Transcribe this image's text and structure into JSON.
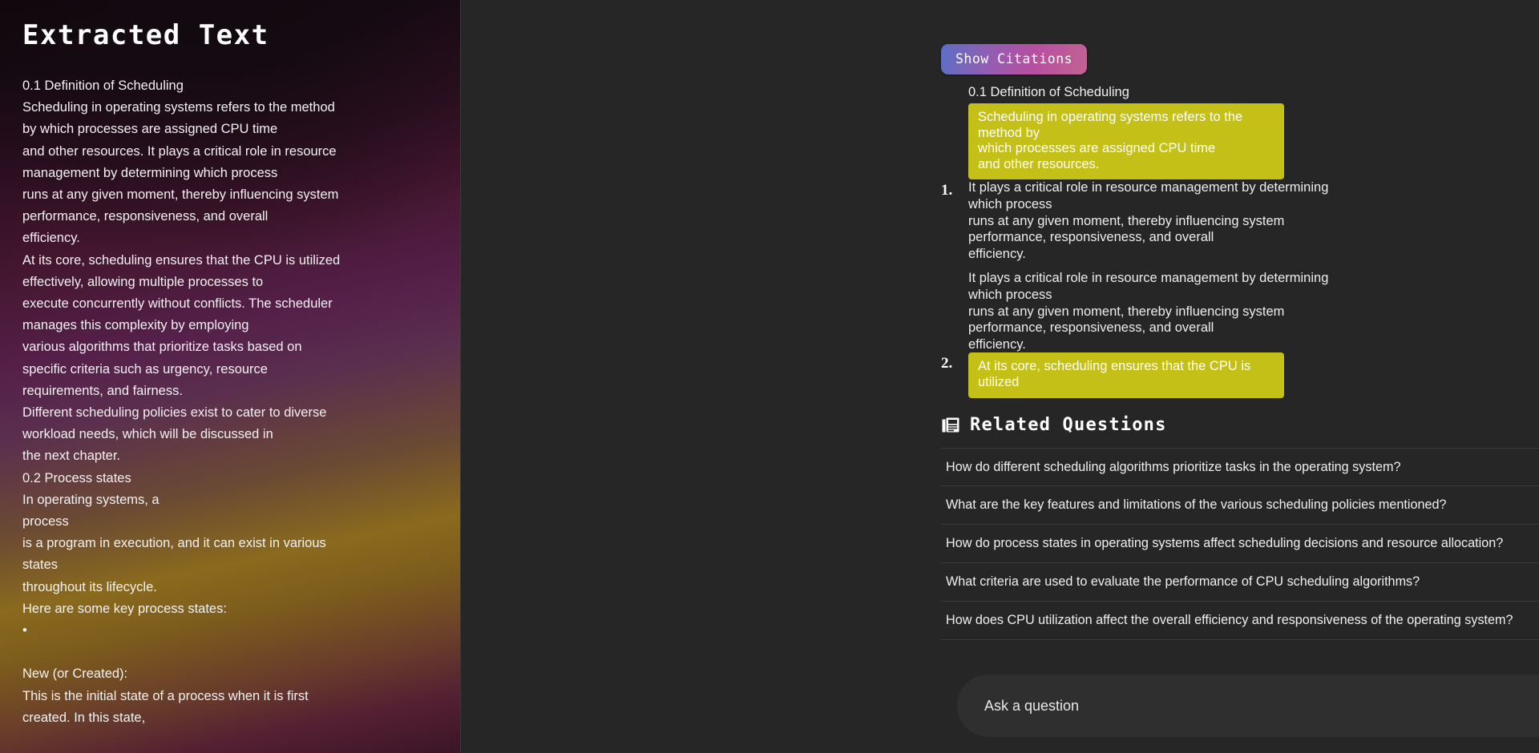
{
  "left_panel": {
    "title": "Extracted Text",
    "lines": [
      "0.1 Definition of Scheduling",
      "Scheduling in operating systems refers to the method",
      "by which processes are assigned CPU time",
      "and other resources. It plays a critical role in resource",
      "management by determining which process",
      "runs at any given moment, thereby influencing system",
      "performance, responsiveness, and overall",
      "efficiency.",
      "At its core, scheduling ensures that the CPU is utilized",
      "effectively, allowing multiple processes to",
      "execute concurrently without conflicts. The scheduler",
      "manages this complexity by employing",
      "various algorithms that prioritize tasks based on",
      "specific criteria such as urgency, resource",
      "requirements, and fairness.",
      "Different scheduling policies exist to cater to diverse",
      "workload needs, which will be discussed in",
      "the next chapter.",
      "0.2 Process states",
      "In operating systems, a",
      "process",
      "is a program in execution, and it can exist in various",
      "states",
      "throughout its lifecycle.",
      "Here are some key process states:",
      "•",
      "",
      "New (or Created):",
      "This is the initial state of a process when it is first",
      "created. In this state,"
    ]
  },
  "citations": {
    "toggle_label": "Show Citations",
    "section_heading": "0.1 Definition of Scheduling",
    "blocks": [
      {
        "marker": "",
        "highlighted": true,
        "lines": [
          "Scheduling in operating systems refers to the method by",
          "which processes are assigned CPU time",
          "and other resources."
        ]
      },
      {
        "marker": "1.",
        "highlighted": false,
        "lines": [
          "It plays a critical role in resource management by determining",
          "which process",
          "runs at any given moment, thereby influencing system",
          "performance, responsiveness, and overall",
          "efficiency."
        ]
      },
      {
        "marker": "",
        "highlighted": false,
        "lines": [
          "It plays a critical role in resource management by determining",
          "which process",
          "runs at any given moment, thereby influencing system",
          "performance, responsiveness, and overall",
          "efficiency."
        ]
      },
      {
        "marker": "2.",
        "highlighted": true,
        "lines": [
          "At its core, scheduling ensures that the CPU is utilized"
        ]
      }
    ]
  },
  "related": {
    "title": "Related Questions",
    "icon": "document-icon",
    "expand_label": "+",
    "questions": [
      "How do different scheduling algorithms prioritize tasks in the operating system?",
      "What are the key features and limitations of the various scheduling policies mentioned?",
      "How do process states in operating systems affect scheduling decisions and resource allocation?",
      "What criteria are used to evaluate the performance of CPU scheduling algorithms?",
      "How does CPU utilization affect the overall efficiency and responsiveness of the operating system?"
    ]
  },
  "ask": {
    "placeholder": "Ask a question",
    "value": "",
    "send_icon": "arrow-up-icon"
  },
  "colors": {
    "highlight": "#c5c017",
    "panel_bg": "#262626",
    "accent_gradient_start": "#5b6fc4",
    "accent_gradient_end": "#c26294"
  }
}
